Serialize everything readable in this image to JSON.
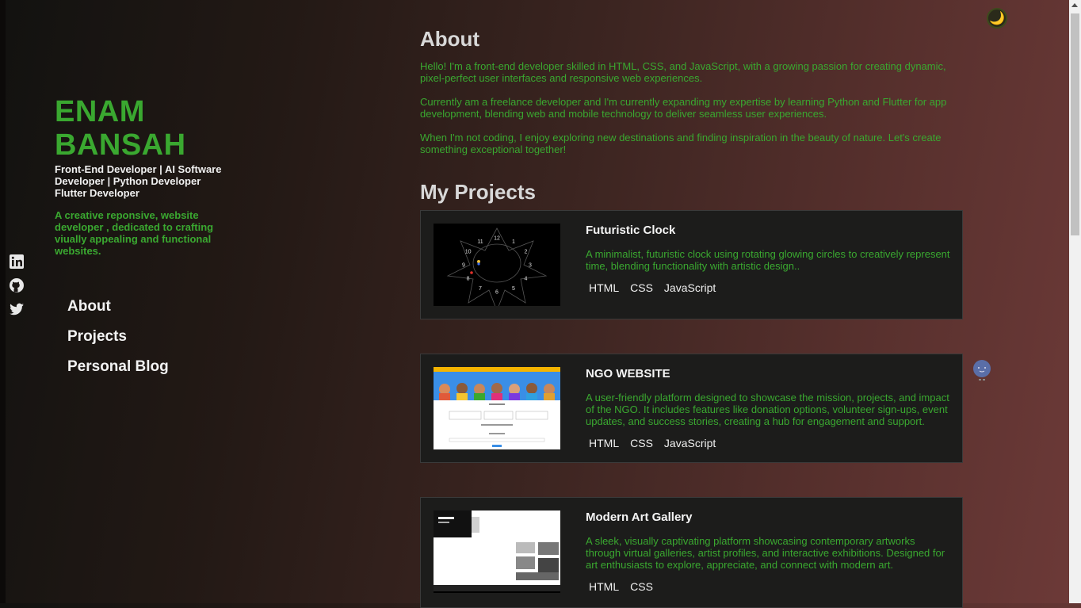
{
  "profile": {
    "name": "ENAM BANSAH",
    "role": "Front-End Developer | AI Software Developer | Python Developer Flutter Developer",
    "tagline": "A creative reponsive, website developer , dedicated to crafting viually appealing and functional websites."
  },
  "socials": [
    {
      "icon": "linkedin-icon"
    },
    {
      "icon": "github-icon"
    },
    {
      "icon": "twitter-icon"
    }
  ],
  "nav": {
    "items": [
      {
        "label": "About"
      },
      {
        "label": "Projects"
      },
      {
        "label": "Personal Blog"
      }
    ]
  },
  "about": {
    "title": "About",
    "paragraphs": [
      "Hello! I'm a front-end developer skilled in HTML, CSS, and JavaScript, with a growing passion for creating dynamic, pixel-perfect user interfaces and responsive web experiences.",
      "Currently am a freelance developer and I'm currently expanding my expertise by learning Python and Flutter for app development, blending web and mobile technology to deliver seamless user experiences.",
      "When I'm not coding, I enjoy exploring new destinations and finding inspiration in the beauty of nature. Let's create something exceptional together!"
    ]
  },
  "projects": {
    "title": "My Projects",
    "items": [
      {
        "title": "Futuristic Clock",
        "description": "A minimalist, futuristic clock using rotating glowing circles to creatively represent time, blending functionality with artistic design..",
        "tags": [
          "HTML",
          "CSS",
          "JavaScript"
        ],
        "clock_numbers": [
          "12",
          "1",
          "2",
          "3",
          "4",
          "5",
          "6",
          "7",
          "8",
          "9",
          "10",
          "11"
        ]
      },
      {
        "title": "NGO WEBSITE",
        "description": "A user-friendly platform designed to showcase the mission, projects, and impact of the NGO. It includes features like donation options, volunteer sign-ups, event updates, and success stories, creating a hub for engagement and support.",
        "tags": [
          "HTML",
          "CSS",
          "JavaScript"
        ]
      },
      {
        "title": "Modern Art Gallery",
        "description": "A sleek, visually captivating platform showcasing contemporary artworks through virtual galleries, artist profiles, and interactive exhibitions. Designed for art enthusiasts to explore, appreciate, and connect with modern art.",
        "tags": [
          "HTML",
          "CSS"
        ]
      }
    ]
  },
  "theme_toggle": {
    "icon": "moon-icon",
    "glyph": "🌙"
  },
  "colors": {
    "accent": "#3aa830",
    "card": "#1c1c1b",
    "text": "#f0f0f0"
  }
}
